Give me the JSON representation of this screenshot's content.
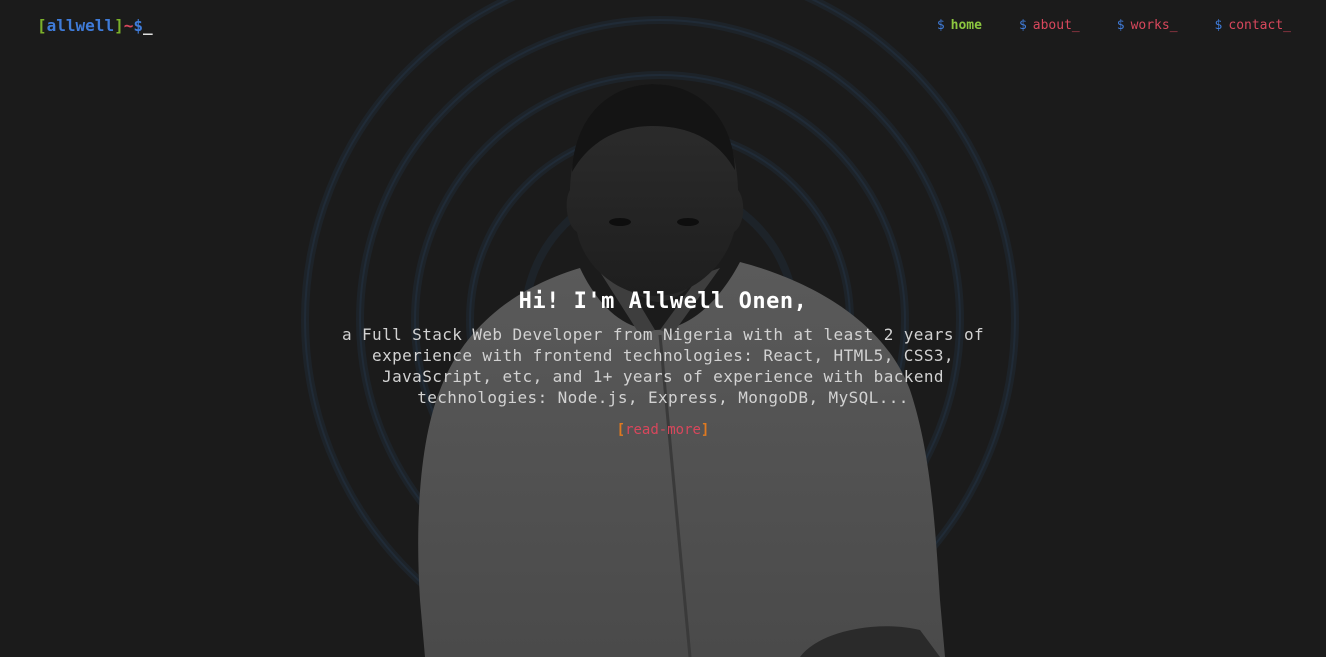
{
  "header": {
    "logo": {
      "open_bracket": "[",
      "name": "allwell",
      "close_bracket": "]",
      "tilde": "~",
      "dollar": "$",
      "cursor": "_"
    },
    "nav": [
      {
        "prompt": "$",
        "label": "home",
        "active": true
      },
      {
        "prompt": "$",
        "label": "about_",
        "active": false
      },
      {
        "prompt": "$",
        "label": "works_",
        "active": false
      },
      {
        "prompt": "$",
        "label": "contact_",
        "active": false
      }
    ]
  },
  "hero": {
    "title": "Hi! I'm Allwell Onen,",
    "description": "a Full Stack Web Developer from Nigeria with at least 2 years of experience with frontend technologies: React, HTML5, CSS3, JavaScript, etc, and 1+ years of experience with backend technologies: Node.js, Express, MongoDB, MySQL...",
    "read_more": {
      "open_bracket": "[",
      "label": "read-more",
      "close_bracket": "]"
    }
  },
  "colors": {
    "background": "#1b1b1b",
    "green": "#8cc63f",
    "blue": "#3f7bd8",
    "red": "#d8475c",
    "orange": "#e07a20"
  }
}
